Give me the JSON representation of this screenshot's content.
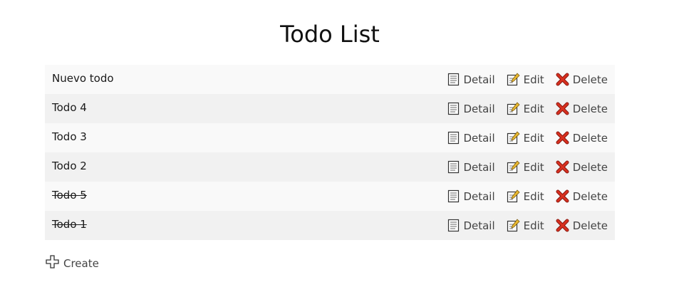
{
  "page": {
    "title": "Todo List"
  },
  "todos": [
    {
      "text": "Nuevo todo",
      "completed": false
    },
    {
      "text": "Todo 4",
      "completed": false
    },
    {
      "text": "Todo 3",
      "completed": false
    },
    {
      "text": "Todo 2",
      "completed": false
    },
    {
      "text": "Todo 5",
      "completed": true
    },
    {
      "text": "Todo 1",
      "completed": true
    }
  ],
  "actions": {
    "detail_label": "Detail",
    "edit_label": "Edit",
    "delete_label": "Delete"
  },
  "footer": {
    "create_label": "Create"
  },
  "icons": {
    "detail": "document-icon",
    "edit": "edit-pencil-icon",
    "delete": "red-x-icon",
    "create": "plus-icon"
  },
  "colors": {
    "row_odd": "#f9f9f9",
    "row_even": "#f1f1f1",
    "delete_red": "#cc2a1f",
    "edit_yellow": "#e8b830"
  }
}
